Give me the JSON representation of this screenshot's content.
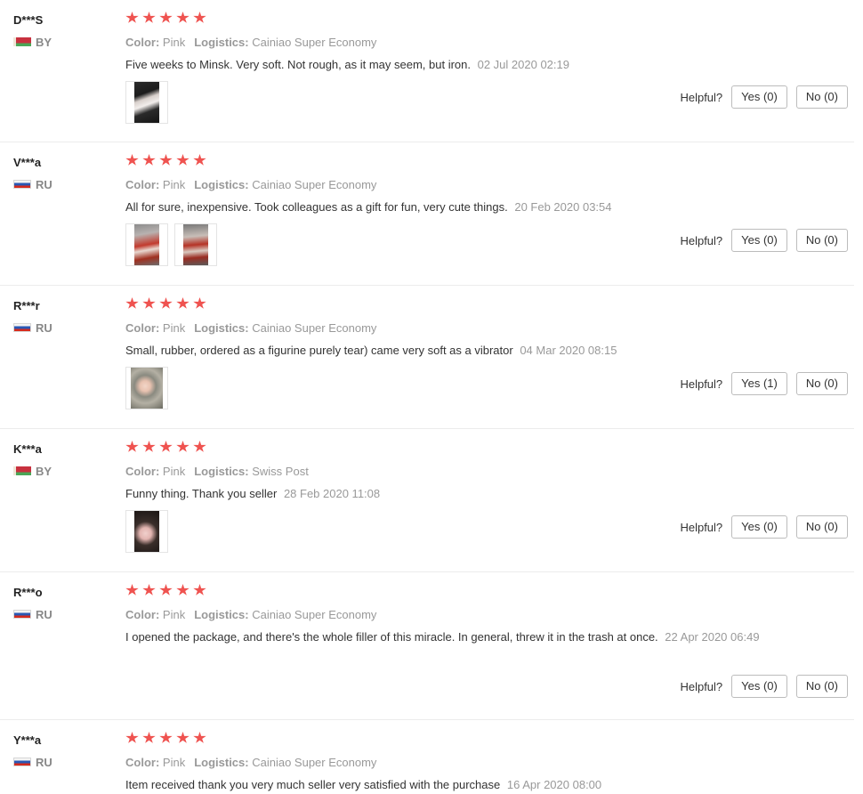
{
  "labels": {
    "color": "Color:",
    "logistics": "Logistics:",
    "helpful": "Helpful?"
  },
  "colors": {
    "star": "#ef5350",
    "meta": "#999999",
    "border": "#ececec"
  },
  "reviews": [
    {
      "user": "D***S",
      "country": "BY",
      "rating": 5,
      "color": "Pink",
      "logistics": "Cainiao Super Economy",
      "text": "Five weeks to Minsk. Very soft. Not rough, as it may seem, but iron.",
      "date": "02 Jul 2020 02:19",
      "photos": 1,
      "yes": "Yes (0)",
      "no": "No (0)"
    },
    {
      "user": "V***a",
      "country": "RU",
      "rating": 5,
      "color": "Pink",
      "logistics": "Cainiao Super Economy",
      "text": "All for sure, inexpensive. Took colleagues as a gift for fun, very cute things.",
      "date": "20 Feb 2020 03:54",
      "photos": 2,
      "yes": "Yes (0)",
      "no": "No (0)"
    },
    {
      "user": "R***r",
      "country": "RU",
      "rating": 5,
      "color": "Pink",
      "logistics": "Cainiao Super Economy",
      "text": "Small, rubber, ordered as a figurine purely tear) came very soft as a vibrator",
      "date": "04 Mar 2020 08:15",
      "photos": 1,
      "yes": "Yes (1)",
      "no": "No (0)"
    },
    {
      "user": "K***a",
      "country": "BY",
      "rating": 5,
      "color": "Pink",
      "logistics": "Swiss Post",
      "text": "Funny thing. Thank you seller",
      "date": "28 Feb 2020 11:08",
      "photos": 1,
      "yes": "Yes (0)",
      "no": "No (0)"
    },
    {
      "user": "R***o",
      "country": "RU",
      "rating": 5,
      "color": "Pink",
      "logistics": "Cainiao Super Economy",
      "text": "I opened the package, and there's the whole filler of this miracle. In general, threw it in the trash at once.",
      "date": "22 Apr 2020 06:49",
      "photos": 0,
      "yes": "Yes (0)",
      "no": "No (0)"
    },
    {
      "user": "Y***a",
      "country": "RU",
      "rating": 5,
      "color": "Pink",
      "logistics": "Cainiao Super Economy",
      "text": "Item received thank you very much seller very satisfied with the purchase",
      "date": "16 Apr 2020 08:00",
      "photos": 0
    }
  ]
}
